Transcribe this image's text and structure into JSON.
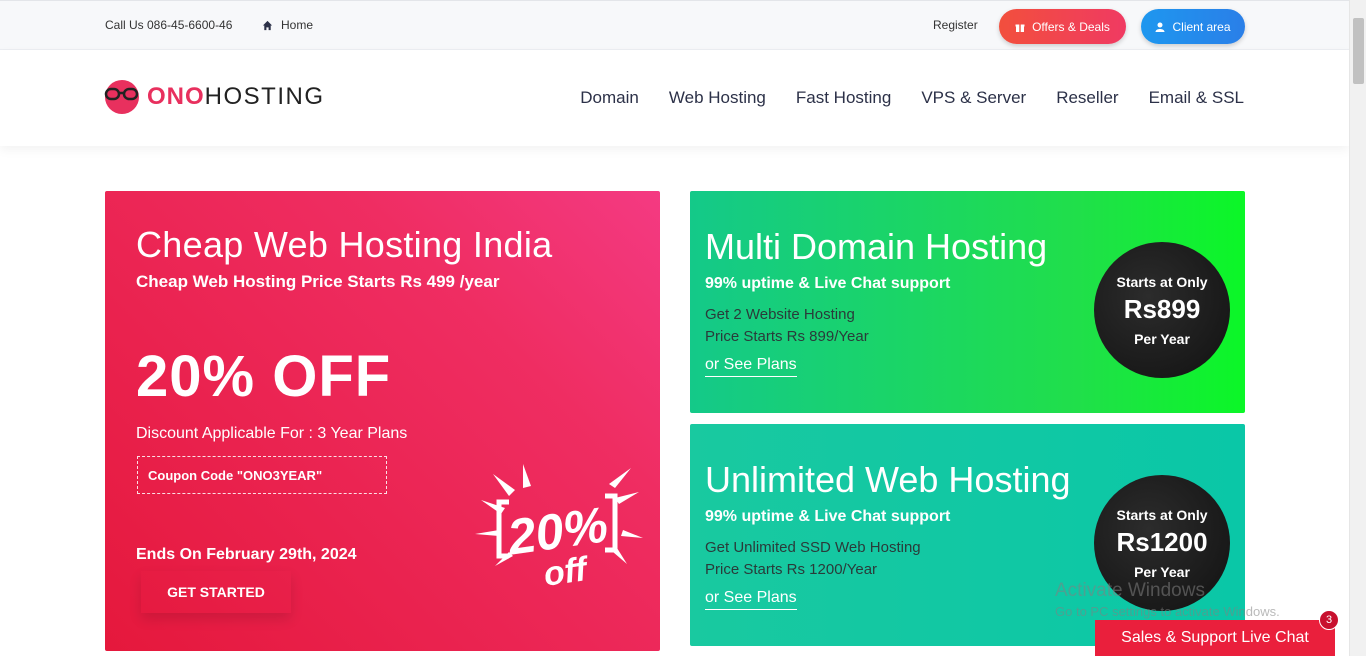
{
  "topbar": {
    "call_text": "Call Us 086-45-6600-46",
    "home_label": "Home",
    "register_label": "Register",
    "offers_label": "Offers & Deals",
    "client_label": "Client area"
  },
  "brand": {
    "ono": "ONO",
    "hosting": "HOSTING"
  },
  "nav": {
    "items": [
      {
        "label": "Domain"
      },
      {
        "label": "Web Hosting"
      },
      {
        "label": "Fast Hosting"
      },
      {
        "label": "VPS & Server"
      },
      {
        "label": "Reseller"
      },
      {
        "label": "Email & SSL"
      }
    ]
  },
  "promo": {
    "title": "Cheap Web Hosting India",
    "subtitle": "Cheap Web Hosting Price Starts Rs 499 /year",
    "discount": "20% OFF",
    "applicable": "Discount Applicable For : 3 Year Plans",
    "coupon": "Coupon Code \"ONO3YEAR\"",
    "ends": "Ends On February 29th, 2024",
    "cta_label": "GET STARTED",
    "badge_pct": "20%",
    "badge_off": "off"
  },
  "cards": [
    {
      "title": "Multi Domain Hosting",
      "subtitle": "99% uptime & Live Chat support",
      "line1": "Get 2 Website Hosting",
      "line2": "Price Starts Rs 899/Year",
      "link": "or See Plans",
      "price_top": "Starts at Only",
      "price": "Rs899",
      "price_bottom": "Per Year"
    },
    {
      "title": "Unlimited Web Hosting",
      "subtitle": "99% uptime & Live Chat support",
      "line1": "Get Unlimited SSD Web Hosting",
      "line2": "Price Starts Rs 1200/Year",
      "link": "or See Plans",
      "price_top": "Starts at Only",
      "price": "Rs1200",
      "price_bottom": "Per Year"
    }
  ],
  "watermark": {
    "line1": "Activate Windows",
    "line2": "Go to PC settings to activate Windows."
  },
  "chat": {
    "label": "Sales & Support Live Chat",
    "count": "3"
  },
  "colors": {
    "brand_pink": "#e8305e",
    "promo_red": "#e5183c",
    "multi_green": "#20df4a",
    "unlimited_teal": "#0ac7a7",
    "client_blue": "#1e97ef"
  }
}
